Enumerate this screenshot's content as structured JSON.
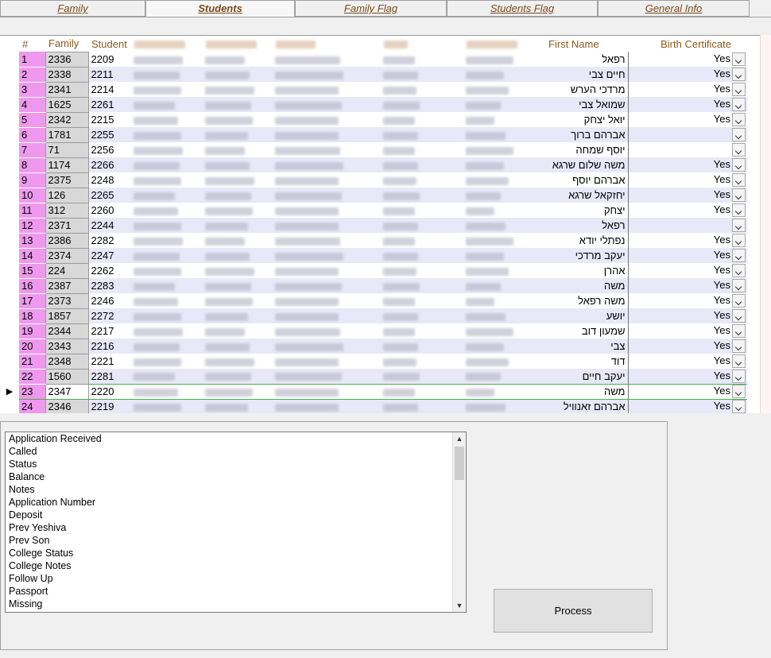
{
  "tabs": [
    {
      "label": "Family",
      "active": false
    },
    {
      "label": "Students",
      "active": true
    },
    {
      "label": "Family Flag",
      "active": false
    },
    {
      "label": "Students Flag",
      "active": false
    },
    {
      "label": "General Info",
      "active": false
    }
  ],
  "grid": {
    "headers": {
      "num": "#",
      "family": "Family",
      "student": "Student",
      "first_name": "First Name",
      "birth_certificate": "Birth Certificate"
    },
    "current_row_index": 22,
    "rows": [
      {
        "num": "1",
        "family": "2336",
        "student": "2209",
        "first_name": "רפאל",
        "bc": "Yes"
      },
      {
        "num": "2",
        "family": "2338",
        "student": "2211",
        "first_name": "חיים צבי",
        "bc": "Yes"
      },
      {
        "num": "3",
        "family": "2341",
        "student": "2214",
        "first_name": "מרדכי הערש",
        "bc": "Yes"
      },
      {
        "num": "4",
        "family": "1625",
        "student": "2261",
        "first_name": "שמואל צבי",
        "bc": "Yes"
      },
      {
        "num": "5",
        "family": "2342",
        "student": "2215",
        "first_name": "יואל יצחק",
        "bc": "Yes"
      },
      {
        "num": "6",
        "family": "1781",
        "student": "2255",
        "first_name": "אברהם ברוך",
        "bc": ""
      },
      {
        "num": "7",
        "family": "71",
        "student": "2256",
        "first_name": "יוסף שמחה",
        "bc": ""
      },
      {
        "num": "8",
        "family": "1174",
        "student": "2266",
        "first_name": "משה שלום שרגא",
        "bc": "Yes"
      },
      {
        "num": "9",
        "family": "2375",
        "student": "2248",
        "first_name": "אברהם יוסף",
        "bc": "Yes"
      },
      {
        "num": "10",
        "family": "126",
        "student": "2265",
        "first_name": "יחזקאל שרגא",
        "bc": "Yes"
      },
      {
        "num": "11",
        "family": "312",
        "student": "2260",
        "first_name": "יצחק",
        "bc": "Yes"
      },
      {
        "num": "12",
        "family": "2371",
        "student": "2244",
        "first_name": "רפאל",
        "bc": ""
      },
      {
        "num": "13",
        "family": "2386",
        "student": "2282",
        "first_name": "נפתלי יודא",
        "bc": "Yes"
      },
      {
        "num": "14",
        "family": "2374",
        "student": "2247",
        "first_name": "יעקב מרדכי",
        "bc": "Yes"
      },
      {
        "num": "15",
        "family": "224",
        "student": "2262",
        "first_name": "אהרן",
        "bc": "Yes"
      },
      {
        "num": "16",
        "family": "2387",
        "student": "2283",
        "first_name": "משה",
        "bc": "Yes"
      },
      {
        "num": "17",
        "family": "2373",
        "student": "2246",
        "first_name": "משה רפאל",
        "bc": "Yes"
      },
      {
        "num": "18",
        "family": "1857",
        "student": "2272",
        "first_name": "יושע",
        "bc": "Yes"
      },
      {
        "num": "19",
        "family": "2344",
        "student": "2217",
        "first_name": "שמעון דוב",
        "bc": "Yes"
      },
      {
        "num": "20",
        "family": "2343",
        "student": "2216",
        "first_name": "צבי",
        "bc": "Yes"
      },
      {
        "num": "21",
        "family": "2348",
        "student": "2221",
        "first_name": "דוד",
        "bc": "Yes"
      },
      {
        "num": "22",
        "family": "1560",
        "student": "2281",
        "first_name": "יעקב חיים",
        "bc": "Yes"
      },
      {
        "num": "23",
        "family": "2347",
        "student": "2220",
        "first_name": "משה",
        "bc": "Yes"
      },
      {
        "num": "24",
        "family": "2346",
        "student": "2219",
        "first_name": "אברהם זאנוויל",
        "bc": "Yes"
      }
    ]
  },
  "listbox": {
    "items": [
      "Application Received",
      "Called",
      "Status",
      "Balance",
      "Notes",
      "Application Number",
      "Deposit",
      "Prev Yeshiva",
      "Prev Son",
      "College Status",
      "College Notes",
      "Follow Up",
      "Passport",
      "Missing"
    ]
  },
  "process_button": {
    "label": "Process"
  },
  "icons": {
    "row_selector": "triangle-right-icon",
    "dropdown": "chevron-down-icon",
    "scroll_up": "scroll-up-arrow-icon",
    "scroll_down": "scroll-down-arrow-icon"
  },
  "colors": {
    "tab_text": "#7a4a1a",
    "header_text": "#8b5a1e",
    "row_number_bg": "#ee99ee",
    "alt_row_bg": "#e8e8f8",
    "current_row_border": "#4caf50"
  }
}
